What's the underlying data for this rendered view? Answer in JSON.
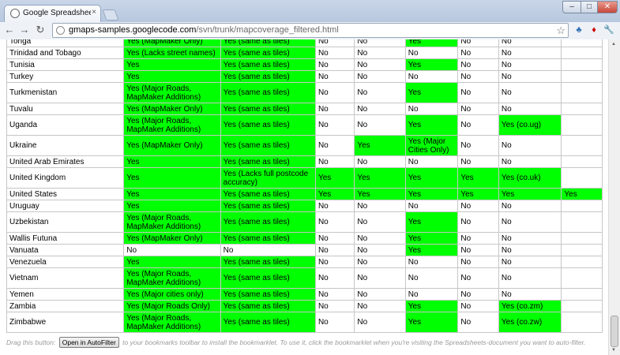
{
  "browser": {
    "tab_title": "Google Spreadsheets Autofi",
    "tab_close": "×",
    "url_host": "gmaps-samples.googlecode.com",
    "url_path": "/svn/trunk/mapcoverage_filtered.html",
    "window_buttons": {
      "minimize": "–",
      "maximize": "□",
      "close": "✕"
    },
    "nav": {
      "back": "←",
      "forward": "→",
      "reload": "↻"
    },
    "star": "☆",
    "extensions": {
      "python": "♣",
      "lastpass": "♦",
      "wrench": "🔧"
    }
  },
  "colors": {
    "yes_green": "#00ff00",
    "grid": "#c6c6c6",
    "footer_text": "#9a9a9a"
  },
  "table": {
    "rows": [
      {
        "country": "Tonga",
        "cells": [
          [
            "Yes (MapMaker Only)",
            1
          ],
          [
            "Yes (same as tiles)",
            1
          ],
          [
            "No",
            0
          ],
          [
            "No",
            0
          ],
          [
            "Yes",
            1
          ],
          [
            "No",
            0
          ],
          [
            "No",
            0
          ],
          [
            "",
            0
          ]
        ]
      },
      {
        "country": "Trinidad and Tobago",
        "cells": [
          [
            "Yes (Lacks street names)",
            1
          ],
          [
            "Yes (same as tiles)",
            1
          ],
          [
            "No",
            0
          ],
          [
            "No",
            0
          ],
          [
            "No",
            0
          ],
          [
            "No",
            0
          ],
          [
            "No",
            0
          ],
          [
            "",
            0
          ]
        ]
      },
      {
        "country": "Tunisia",
        "cells": [
          [
            "Yes",
            1
          ],
          [
            "Yes (same as tiles)",
            1
          ],
          [
            "No",
            0
          ],
          [
            "No",
            0
          ],
          [
            "Yes",
            1
          ],
          [
            "No",
            0
          ],
          [
            "No",
            0
          ],
          [
            "",
            0
          ]
        ]
      },
      {
        "country": "Turkey",
        "cells": [
          [
            "Yes",
            1
          ],
          [
            "Yes (same as tiles)",
            1
          ],
          [
            "No",
            0
          ],
          [
            "No",
            0
          ],
          [
            "No",
            0
          ],
          [
            "No",
            0
          ],
          [
            "No",
            0
          ],
          [
            "",
            0
          ]
        ]
      },
      {
        "country": "Turkmenistan",
        "cells": [
          [
            "Yes (Major Roads, MapMaker Additions)",
            1
          ],
          [
            "Yes (same as tiles)",
            1
          ],
          [
            "No",
            0
          ],
          [
            "No",
            0
          ],
          [
            "Yes",
            1
          ],
          [
            "No",
            0
          ],
          [
            "No",
            0
          ],
          [
            "",
            0
          ]
        ]
      },
      {
        "country": "Tuvalu",
        "cells": [
          [
            "Yes (MapMaker Only)",
            1
          ],
          [
            "Yes (same as tiles)",
            1
          ],
          [
            "No",
            0
          ],
          [
            "No",
            0
          ],
          [
            "No",
            0
          ],
          [
            "No",
            0
          ],
          [
            "No",
            0
          ],
          [
            "",
            0
          ]
        ]
      },
      {
        "country": "Uganda",
        "cells": [
          [
            "Yes (Major Roads, MapMaker Additions)",
            1
          ],
          [
            "Yes (same as tiles)",
            1
          ],
          [
            "No",
            0
          ],
          [
            "No",
            0
          ],
          [
            "Yes",
            1
          ],
          [
            "No",
            0
          ],
          [
            "Yes (co.ug)",
            1
          ],
          [
            "",
            0
          ]
        ]
      },
      {
        "country": "Ukraine",
        "cells": [
          [
            "Yes (MapMaker Only)",
            1
          ],
          [
            "Yes (same as tiles)",
            1
          ],
          [
            "No",
            0
          ],
          [
            "Yes",
            1
          ],
          [
            "Yes (Major Cities Only)",
            1
          ],
          [
            "No",
            0
          ],
          [
            "No",
            0
          ],
          [
            "",
            0
          ]
        ]
      },
      {
        "country": "United Arab Emirates",
        "cells": [
          [
            "Yes",
            1
          ],
          [
            "Yes (same as tiles)",
            1
          ],
          [
            "No",
            0
          ],
          [
            "No",
            0
          ],
          [
            "No",
            0
          ],
          [
            "No",
            0
          ],
          [
            "No",
            0
          ],
          [
            "",
            0
          ]
        ]
      },
      {
        "country": "United Kingdom",
        "cells": [
          [
            "Yes",
            1
          ],
          [
            "Yes (Lacks full postcode accuracy)",
            1
          ],
          [
            "Yes",
            1
          ],
          [
            "Yes",
            1
          ],
          [
            "Yes",
            1
          ],
          [
            "Yes",
            1
          ],
          [
            "Yes (co.uk)",
            1
          ],
          [
            "",
            0
          ]
        ]
      },
      {
        "country": "United States",
        "cells": [
          [
            "Yes",
            1
          ],
          [
            "Yes (same as tiles)",
            1
          ],
          [
            "Yes",
            1
          ],
          [
            "Yes",
            1
          ],
          [
            "Yes",
            1
          ],
          [
            "Yes",
            1
          ],
          [
            "Yes",
            1
          ],
          [
            "Yes",
            1
          ]
        ]
      },
      {
        "country": "Uruguay",
        "cells": [
          [
            "Yes",
            1
          ],
          [
            "Yes (same as tiles)",
            1
          ],
          [
            "No",
            0
          ],
          [
            "No",
            0
          ],
          [
            "No",
            0
          ],
          [
            "No",
            0
          ],
          [
            "No",
            0
          ],
          [
            "",
            0
          ]
        ]
      },
      {
        "country": "Uzbekistan",
        "cells": [
          [
            "Yes (Major Roads, MapMaker Additions)",
            1
          ],
          [
            "Yes (same as tiles)",
            1
          ],
          [
            "No",
            0
          ],
          [
            "No",
            0
          ],
          [
            "Yes",
            1
          ],
          [
            "No",
            0
          ],
          [
            "No",
            0
          ],
          [
            "",
            0
          ]
        ]
      },
      {
        "country": "Wallis Futuna",
        "cells": [
          [
            "Yes (MapMaker Only)",
            1
          ],
          [
            "Yes (same as tiles)",
            1
          ],
          [
            "No",
            0
          ],
          [
            "No",
            0
          ],
          [
            "Yes",
            1
          ],
          [
            "No",
            0
          ],
          [
            "No",
            0
          ],
          [
            "",
            0
          ]
        ]
      },
      {
        "country": "Vanuata",
        "cells": [
          [
            "No",
            0
          ],
          [
            "No",
            0
          ],
          [
            "No",
            0
          ],
          [
            "No",
            0
          ],
          [
            "Yes",
            1
          ],
          [
            "No",
            0
          ],
          [
            "No",
            0
          ],
          [
            "",
            0
          ]
        ]
      },
      {
        "country": "Venezuela",
        "cells": [
          [
            "Yes",
            1
          ],
          [
            "Yes (same as tiles)",
            1
          ],
          [
            "No",
            0
          ],
          [
            "No",
            0
          ],
          [
            "No",
            0
          ],
          [
            "No",
            0
          ],
          [
            "No",
            0
          ],
          [
            "",
            0
          ]
        ]
      },
      {
        "country": "Vietnam",
        "cells": [
          [
            "Yes (Major Roads, MapMaker Additions)",
            1
          ],
          [
            "Yes (same as tiles)",
            1
          ],
          [
            "No",
            0
          ],
          [
            "No",
            0
          ],
          [
            "No",
            0
          ],
          [
            "No",
            0
          ],
          [
            "No",
            0
          ],
          [
            "",
            0
          ]
        ]
      },
      {
        "country": "Yemen",
        "cells": [
          [
            "Yes (Major cities only)",
            1
          ],
          [
            "Yes (same as tiles)",
            1
          ],
          [
            "No",
            0
          ],
          [
            "No",
            0
          ],
          [
            "No",
            0
          ],
          [
            "No",
            0
          ],
          [
            "No",
            0
          ],
          [
            "",
            0
          ]
        ]
      },
      {
        "country": "Zambia",
        "cells": [
          [
            "Yes (Major Roads Only)",
            1
          ],
          [
            "Yes (same as tiles)",
            1
          ],
          [
            "No",
            0
          ],
          [
            "No",
            0
          ],
          [
            "Yes",
            1
          ],
          [
            "No",
            0
          ],
          [
            "Yes (co.zm)",
            1
          ],
          [
            "",
            0
          ]
        ]
      },
      {
        "country": "Zimbabwe",
        "cells": [
          [
            "Yes (Major Roads, MapMaker Additions)",
            1
          ],
          [
            "Yes (same as tiles)",
            1
          ],
          [
            "No",
            0
          ],
          [
            "No",
            0
          ],
          [
            "Yes",
            1
          ],
          [
            "No",
            0
          ],
          [
            "Yes (co.zw)",
            1
          ],
          [
            "",
            0
          ]
        ]
      }
    ]
  },
  "footer": {
    "before": "Drag this button: ",
    "button_label": "Open in AutoFilter",
    "after": " to your bookmarks toolbar to install the bookmarklet. To use it, click the bookmarklet when you're visiting the Spreadsheets-document you want to auto-filter."
  }
}
